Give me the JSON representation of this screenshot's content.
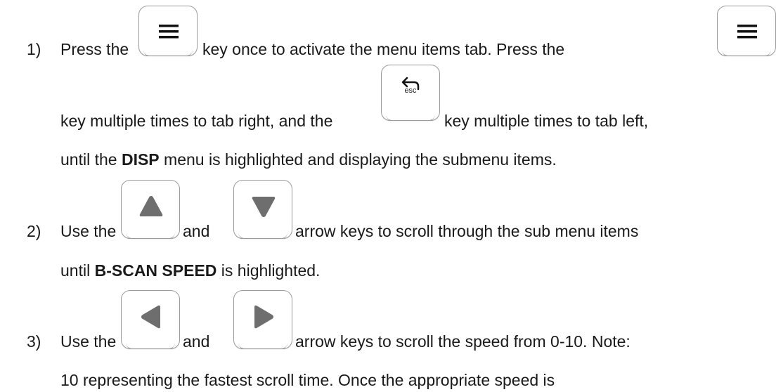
{
  "steps": [
    {
      "number": "1)",
      "lines": [
        [
          "Press the",
          "key once to activate the menu items tab.  Press the"
        ],
        [
          "key multiple times to tab right, and the",
          "key multiple times to tab left,"
        ],
        [
          "until the ",
          "DISP",
          " menu is highlighted and displaying the submenu items."
        ]
      ]
    },
    {
      "number": "2)",
      "lines": [
        [
          "Use the",
          "and",
          "arrow keys to scroll through the sub menu items"
        ],
        [
          "until ",
          "B-SCAN SPEED",
          " is highlighted."
        ]
      ]
    },
    {
      "number": "3)",
      "lines": [
        [
          "Use the",
          "and",
          "arrow keys to scroll the speed from 0-10.  Note:"
        ],
        [
          "10 representing the fastest scroll time.  Once the appropriate speed is"
        ]
      ]
    }
  ],
  "keys": {
    "menu_icon": "menu-icon",
    "esc_label": "esc",
    "esc_icon": "back-arrow-icon",
    "up_icon": "triangle-up-icon",
    "down_icon": "triangle-down-icon",
    "left_icon": "triangle-left-icon",
    "right_icon": "triangle-right-icon"
  },
  "colors": {
    "text": "#1a1a1a",
    "key_border": "#9a9a9a",
    "key_glyph": "#6e6e6e"
  }
}
